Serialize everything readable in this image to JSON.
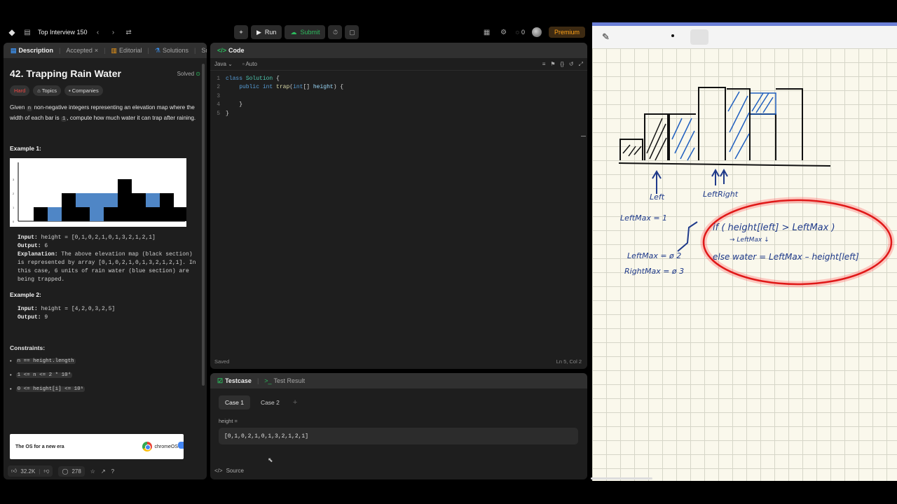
{
  "topbar": {
    "title": "Top Interview 150",
    "run_label": "Run",
    "submit_label": "Submit",
    "streak_count": "0",
    "premium_label": "Premium"
  },
  "desc_tabs": [
    {
      "label": "Description"
    },
    {
      "label": "Accepted"
    },
    {
      "label": "Editorial"
    },
    {
      "label": "Solutions"
    },
    {
      "label": "Su"
    }
  ],
  "problem": {
    "title": "42. Trapping Rain Water",
    "status": "Solved",
    "difficulty": "Hard",
    "topics_label": "Topics",
    "companies_label": "Companies",
    "statement_1": "Given ",
    "statement_n": "n",
    "statement_2": " non-negative integers representing an elevation map where the width of each bar is ",
    "statement_one": "1",
    "statement_3": ", compute how much water it can trap after raining."
  },
  "example1": {
    "title": "Example 1:",
    "input_label": "Input:",
    "input_value": " height = [0,1,0,2,1,0,1,3,2,1,2,1]",
    "output_label": "Output:",
    "output_value": " 6",
    "explanation_label": "Explanation:",
    "explanation_value": " The above elevation map (black section) is represented by array [0,1,0,2,1,0,1,3,2,1,2,1]. In this case, 6 units of rain water (blue section) are being trapped."
  },
  "example2": {
    "title": "Example 2:",
    "input_label": "Input:",
    "input_value": " height = [4,2,0,3,2,5]",
    "output_label": "Output:",
    "output_value": " 9"
  },
  "constraints": {
    "title": "Constraints:",
    "items": [
      "n == height.length",
      "1 <= n <= 2 * 10⁴",
      "0 <= height[i] <= 10⁵"
    ]
  },
  "ad": {
    "text": "The OS for a new era",
    "brand": "chromeOS"
  },
  "desc_footer": {
    "likes": "32.2K",
    "comments": "278"
  },
  "code_panel": {
    "title": "Code",
    "language": "Java",
    "mode": "Auto",
    "lines": [
      {
        "num": "1",
        "text": "class Solution {"
      },
      {
        "num": "2",
        "text": "    public int trap(int[] height) {"
      },
      {
        "num": "3",
        "text": ""
      },
      {
        "num": "4",
        "text": "    }"
      },
      {
        "num": "5",
        "text": "}"
      }
    ],
    "status": "Saved",
    "cursor": "Ln 5, Col 2"
  },
  "tests_panel": {
    "tab_testcase": "Testcase",
    "tab_result": "Test Result",
    "case1": "Case 1",
    "case2": "Case 2",
    "param_label": "height =",
    "param_value": "[0,1,0,2,1,0,1,3,2,1,2,1]",
    "source_label": "Source"
  },
  "whiteboard": {
    "label_left": "Left",
    "label_leftright": "LeftRight",
    "leftmax_eq": "LeftMax = 1",
    "if_line": "if ( height[left] > LeftMax )",
    "if_sub": "→ LeftMax ↓",
    "else_line": "else  water = LeftMax – height[left]",
    "leftmax2": "LeftMax = ø 2",
    "rightmax": "RightMax = ø 3"
  },
  "figure_heights": [
    0,
    1,
    0,
    2,
    1,
    0,
    1,
    3,
    2,
    1,
    2,
    1
  ],
  "colors": {
    "accent_green": "#2cbb5d",
    "hard_red": "#ef4743",
    "premium_orange": "#ffa116",
    "ink_blue": "#1f3a8a",
    "highlight_red": "#e01818"
  }
}
